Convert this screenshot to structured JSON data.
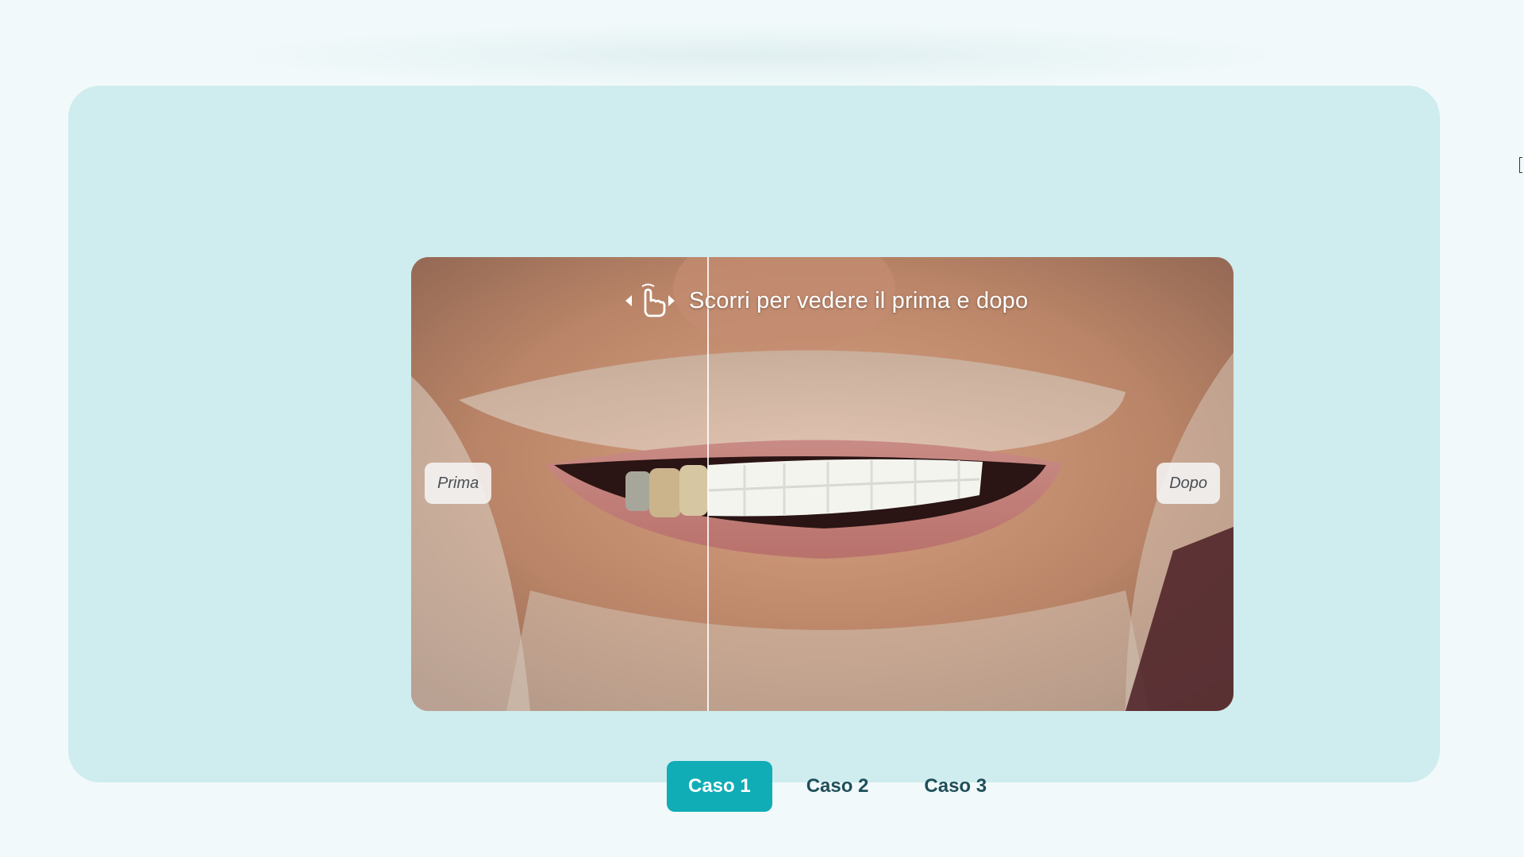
{
  "comparison": {
    "hint_text": "Scorri per vedere il prima e dopo",
    "hint_icon": "drag-hand-icon",
    "before_label": "Prima",
    "after_label": "Dopo",
    "split_position_percent": 36
  },
  "cases": {
    "tabs": [
      {
        "label": "Caso 1",
        "active": true
      },
      {
        "label": "Caso 2",
        "active": false
      },
      {
        "label": "Caso 3",
        "active": false
      }
    ]
  },
  "colors": {
    "page_background": "#f1f9fa",
    "card_background": "#cfecee",
    "active_tab": "#10adb6",
    "tab_text": "#1f4f5a"
  }
}
